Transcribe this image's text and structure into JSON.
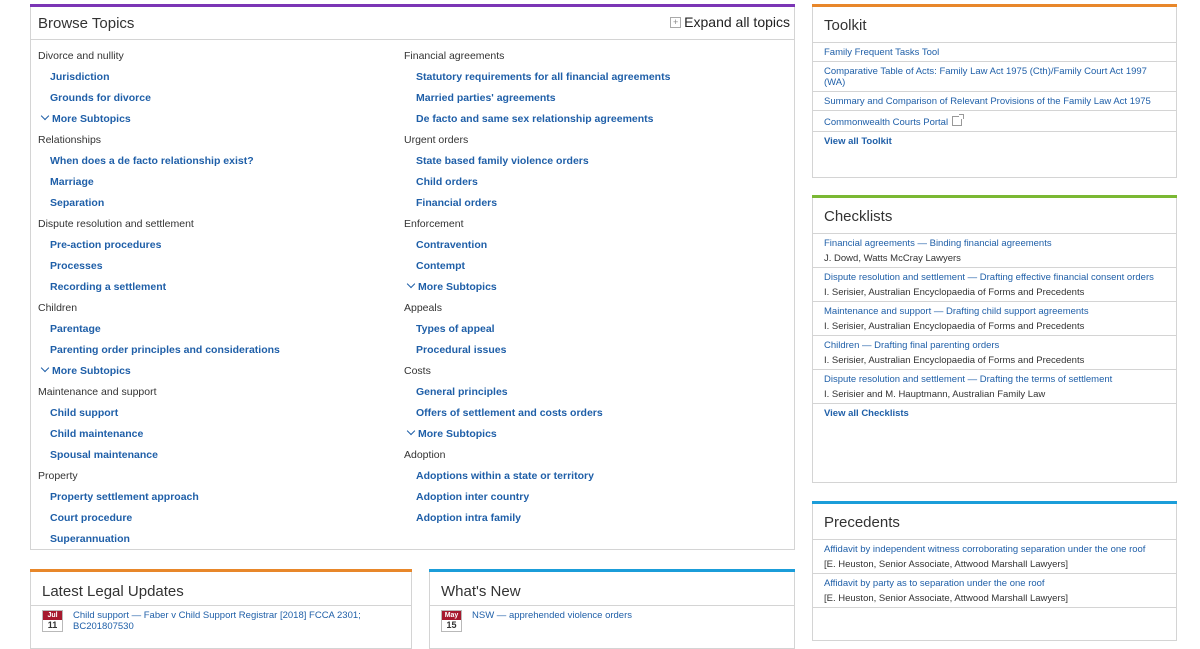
{
  "browse": {
    "title": "Browse Topics",
    "expand_label": "Expand all topics",
    "col1": [
      {
        "type": "cat",
        "text": "Divorce and nullity"
      },
      {
        "type": "sub",
        "text": "Jurisdiction"
      },
      {
        "type": "sub",
        "text": "Grounds for divorce"
      },
      {
        "type": "more",
        "text": "More Subtopics"
      },
      {
        "type": "cat",
        "text": "Relationships"
      },
      {
        "type": "sub",
        "text": "When does a de facto relationship exist?"
      },
      {
        "type": "sub",
        "text": "Marriage"
      },
      {
        "type": "sub",
        "text": "Separation"
      },
      {
        "type": "cat",
        "text": "Dispute resolution and settlement"
      },
      {
        "type": "sub",
        "text": "Pre-action procedures"
      },
      {
        "type": "sub",
        "text": "Processes"
      },
      {
        "type": "sub",
        "text": "Recording a settlement"
      },
      {
        "type": "cat",
        "text": "Children"
      },
      {
        "type": "sub",
        "text": "Parentage"
      },
      {
        "type": "sub",
        "text": "Parenting order principles and considerations"
      },
      {
        "type": "more",
        "text": "More Subtopics"
      },
      {
        "type": "cat",
        "text": "Maintenance and support"
      },
      {
        "type": "sub",
        "text": "Child support"
      },
      {
        "type": "sub",
        "text": "Child maintenance"
      },
      {
        "type": "sub",
        "text": "Spousal maintenance"
      },
      {
        "type": "cat",
        "text": "Property"
      },
      {
        "type": "sub",
        "text": "Property settlement approach"
      },
      {
        "type": "sub",
        "text": "Court procedure"
      },
      {
        "type": "sub",
        "text": "Superannuation"
      }
    ],
    "col2": [
      {
        "type": "cat",
        "text": "Financial agreements"
      },
      {
        "type": "sub",
        "text": "Statutory requirements for all financial agreements"
      },
      {
        "type": "sub",
        "text": "Married parties' agreements"
      },
      {
        "type": "sub",
        "text": "De facto and same sex relationship agreements"
      },
      {
        "type": "cat",
        "text": "Urgent orders"
      },
      {
        "type": "sub",
        "text": "State based family violence orders"
      },
      {
        "type": "sub",
        "text": "Child orders"
      },
      {
        "type": "sub",
        "text": "Financial orders"
      },
      {
        "type": "cat",
        "text": "Enforcement"
      },
      {
        "type": "sub",
        "text": "Contravention"
      },
      {
        "type": "sub",
        "text": "Contempt"
      },
      {
        "type": "more",
        "text": "More Subtopics"
      },
      {
        "type": "cat",
        "text": "Appeals"
      },
      {
        "type": "sub",
        "text": "Types of appeal"
      },
      {
        "type": "sub",
        "text": "Procedural issues"
      },
      {
        "type": "cat",
        "text": "Costs"
      },
      {
        "type": "sub",
        "text": "General principles"
      },
      {
        "type": "sub",
        "text": "Offers of settlement and costs orders"
      },
      {
        "type": "more",
        "text": "More Subtopics"
      },
      {
        "type": "cat",
        "text": "Adoption"
      },
      {
        "type": "sub",
        "text": "Adoptions within a state or territory"
      },
      {
        "type": "sub",
        "text": "Adoption inter country"
      },
      {
        "type": "sub",
        "text": "Adoption intra family"
      }
    ]
  },
  "toolkit": {
    "title": "Toolkit",
    "items": [
      {
        "link": "Family Frequent Tasks Tool",
        "meta": "",
        "ext": false
      },
      {
        "link": "Comparative Table of Acts: Family Law Act 1975 (Cth)/Family Court Act 1997 (WA)",
        "meta": "",
        "ext": false
      },
      {
        "link": "Summary and Comparison of Relevant Provisions of the Family Law Act 1975",
        "meta": "",
        "ext": false
      },
      {
        "link": "Commonwealth Courts Portal",
        "meta": "",
        "ext": true
      }
    ],
    "view_all": "View all Toolkit"
  },
  "checklists": {
    "title": "Checklists",
    "items": [
      {
        "link": "Financial agreements — Binding financial agreements",
        "meta": "J. Dowd, Watts McCray Lawyers",
        "ext": false
      },
      {
        "link": "Dispute resolution and settlement — Drafting effective financial consent orders",
        "meta": "I. Serisier, Australian Encyclopaedia of Forms and Precedents",
        "ext": false
      },
      {
        "link": "Maintenance and support — Drafting child support agreements",
        "meta": "I. Serisier, Australian Encyclopaedia of Forms and Precedents",
        "ext": false
      },
      {
        "link": "Children — Drafting final parenting orders",
        "meta": "I. Serisier, Australian Encyclopaedia of Forms and Precedents",
        "ext": false
      },
      {
        "link": "Dispute resolution and settlement — Drafting the terms of settlement",
        "meta": "I. Serisier and M. Hauptmann, Australian Family Law",
        "ext": false
      }
    ],
    "view_all": "View all Checklists"
  },
  "precedents": {
    "title": "Precedents",
    "items": [
      {
        "link": "Affidavit by independent witness corroborating separation under the one roof",
        "meta": "[E. Heuston, Senior Associate, Attwood Marshall Lawyers]",
        "ext": false
      },
      {
        "link": "Affidavit by party as to separation under the one roof",
        "meta": "[E. Heuston, Senior Associate, Attwood Marshall Lawyers]",
        "ext": false
      }
    ]
  },
  "latest": {
    "title": "Latest Legal Updates",
    "month": "Jul",
    "day": "11",
    "text": "Child support — Faber v Child Support Registrar [2018] FCCA 2301; BC201807530"
  },
  "whatsnew": {
    "title": "What's New",
    "month": "May",
    "day": "15",
    "text": "NSW — apprehended violence orders"
  },
  "colors": {
    "purple": "#7b35b5",
    "orange": "#e8872a",
    "green": "#7ab833",
    "blue": "#1b9dd9",
    "link": "#1f5fa8",
    "calendar_red": "#a6192e"
  }
}
